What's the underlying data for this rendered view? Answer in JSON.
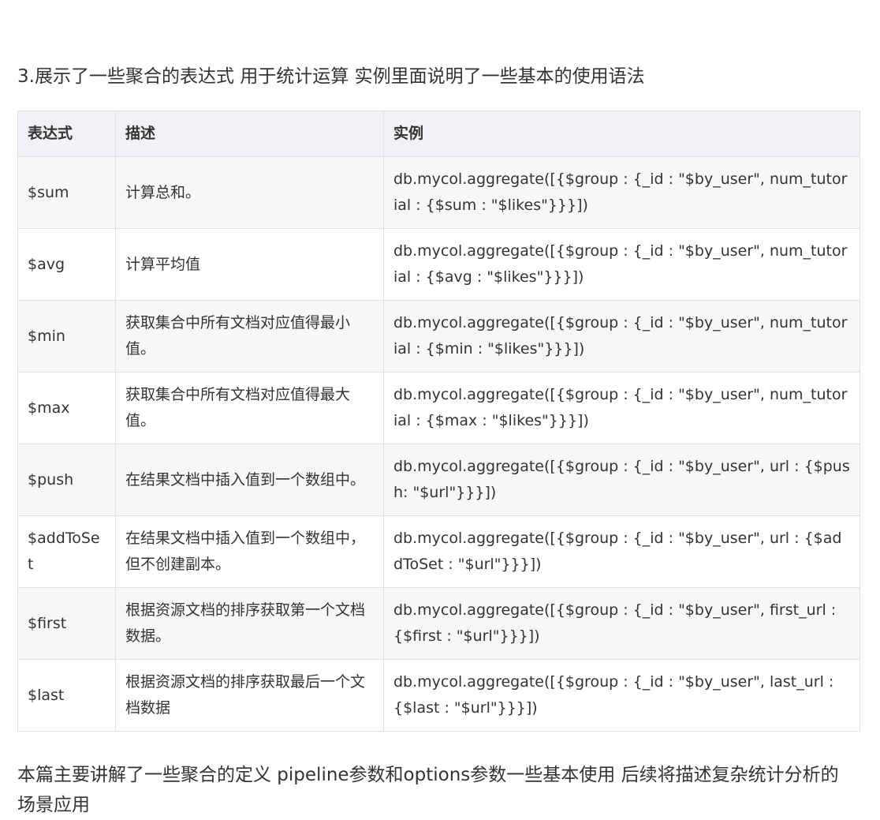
{
  "heading": "3.展示了一些聚合的表达式 用于统计运算 实例里面说明了一些基本的使用语法",
  "table": {
    "headers": [
      "表达式",
      "描述",
      "实例"
    ],
    "rows": [
      {
        "expr": "$sum",
        "desc": "计算总和。",
        "example": "db.mycol.aggregate([{$group : {_id : \"$by_user\", num_tutorial : {$sum : \"$likes\"}}}])"
      },
      {
        "expr": "$avg",
        "desc": "计算平均值",
        "example": "db.mycol.aggregate([{$group : {_id : \"$by_user\", num_tutorial : {$avg : \"$likes\"}}}])"
      },
      {
        "expr": "$min",
        "desc": "获取集合中所有文档对应值得最小值。",
        "example": "db.mycol.aggregate([{$group : {_id : \"$by_user\", num_tutorial : {$min : \"$likes\"}}}])"
      },
      {
        "expr": "$max",
        "desc": "获取集合中所有文档对应值得最大值。",
        "example": "db.mycol.aggregate([{$group : {_id : \"$by_user\", num_tutorial : {$max : \"$likes\"}}}])"
      },
      {
        "expr": "$push",
        "desc": "在结果文档中插入值到一个数组中。",
        "example": "db.mycol.aggregate([{$group : {_id : \"$by_user\", url : {$push: \"$url\"}}}])"
      },
      {
        "expr": "$addToSet",
        "desc": "在结果文档中插入值到一个数组中，但不创建副本。",
        "example": "db.mycol.aggregate([{$group : {_id : \"$by_user\", url : {$addToSet : \"$url\"}}}])"
      },
      {
        "expr": "$first",
        "desc": "根据资源文档的排序获取第一个文档数据。",
        "example": "db.mycol.aggregate([{$group : {_id : \"$by_user\", first_url : {$first : \"$url\"}}}])"
      },
      {
        "expr": "$last",
        "desc": "根据资源文档的排序获取最后一个文档数据",
        "example": "db.mycol.aggregate([{$group : {_id : \"$by_user\", last_url : {$last : \"$url\"}}}])"
      }
    ]
  },
  "footer": "本篇主要讲解了一些聚合的定义 pipeline参数和options参数一些基本使用  后续将描述复杂统计分析的场景应用"
}
